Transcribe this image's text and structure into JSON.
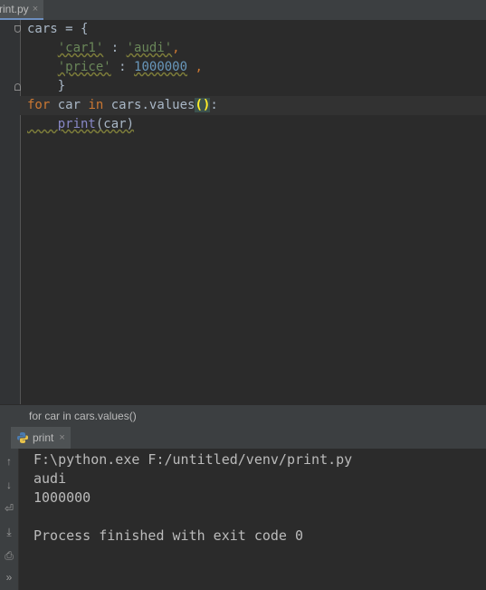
{
  "editor_tab": {
    "filename": "rint.py",
    "close": "×"
  },
  "code": {
    "line1": {
      "name": "cars",
      "eq": " = {"
    },
    "line2": {
      "key": "'car1'",
      "colon": " : ",
      "val": "'audi'",
      "comma": ","
    },
    "line3": {
      "key": "'price'",
      "colon": " : ",
      "val": "1000000",
      "comma": ","
    },
    "line4": {
      "text": "}"
    },
    "line5": {
      "kw_for": "for",
      "var": " car ",
      "kw_in": "in",
      "rest": " cars.values",
      "parens": "()",
      "colon": ":"
    },
    "line6": {
      "fn": "print",
      "args": "(car)"
    }
  },
  "breadcrumb": {
    "text": "for car in cars.values()"
  },
  "run_panel": {
    "tab_label": "print",
    "close": "×",
    "console_lines": [
      "F:\\python.exe F:/untitled/venv/print.py",
      "audi",
      "1000000",
      "",
      "Process finished with exit code 0"
    ]
  },
  "icons": {
    "up": "↑",
    "down": "↓",
    "wrap": "⏎",
    "scroll_end": "⤓",
    "print": "⎙",
    "more": "»"
  },
  "colors": {
    "keyword": "#cc7832",
    "string": "#6a8759",
    "number": "#6897bb",
    "builtin": "#8888c6"
  }
}
